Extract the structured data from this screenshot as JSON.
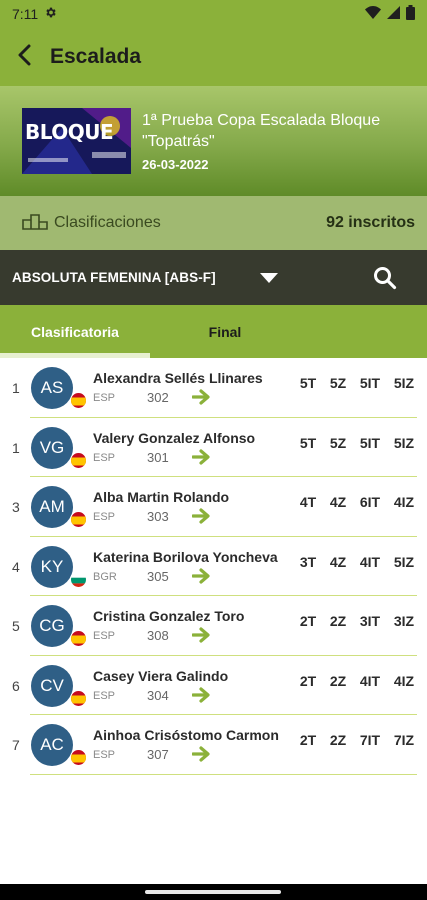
{
  "status_bar": {
    "time": "7:11",
    "settings_icon": "gear-icon",
    "wifi_icon": "wifi-icon",
    "signal_icon": "signal-icon",
    "battery_icon": "battery-icon"
  },
  "app_bar": {
    "title": "Escalada",
    "back_icon": "arrow-back-icon"
  },
  "event": {
    "thumbnail_text": "BLOQUE",
    "title": "1ª Prueba Copa Escalada Bloque \"Topatrás\"",
    "date": "26-03-2022"
  },
  "classification": {
    "label": "Clasificaciones",
    "icon": "podium-icon",
    "registered": "92 inscritos"
  },
  "category": {
    "selected": "ABSOLUTA FEMENINA [ABS-F]",
    "dropdown_icon": "caret-down-icon",
    "search_icon": "search-icon"
  },
  "tabs": [
    {
      "label": "Clasificatoria",
      "active": true
    },
    {
      "label": "Final",
      "active": false
    }
  ],
  "results": [
    {
      "rank": "1",
      "initials": "AS",
      "name": "Alexandra  Sellés Llinares",
      "country": "ESP",
      "flag": "spain-flag",
      "dorsal": "302",
      "tops": "5T",
      "zones": "5Z",
      "top_attempts": "5IT",
      "zone_attempts": "5IZ"
    },
    {
      "rank": "1",
      "initials": "VG",
      "name": "Valery Gonzalez Alfonso",
      "country": "ESP",
      "flag": "spain-flag",
      "dorsal": "301",
      "tops": "5T",
      "zones": "5Z",
      "top_attempts": "5IT",
      "zone_attempts": "5IZ"
    },
    {
      "rank": "3",
      "initials": "AM",
      "name": "Alba Martin Rolando",
      "country": "ESP",
      "flag": "spain-flag",
      "dorsal": "303",
      "tops": "4T",
      "zones": "4Z",
      "top_attempts": "6IT",
      "zone_attempts": "4IZ"
    },
    {
      "rank": "4",
      "initials": "KY",
      "name": "Katerina Borilova Yoncheva",
      "country": "BGR",
      "flag": "bulgaria-flag",
      "dorsal": "305",
      "tops": "3T",
      "zones": "4Z",
      "top_attempts": "4IT",
      "zone_attempts": "5IZ"
    },
    {
      "rank": "5",
      "initials": "CG",
      "name": "Cristina Gonzalez Toro",
      "country": "ESP",
      "flag": "spain-flag",
      "dorsal": "308",
      "tops": "2T",
      "zones": "2Z",
      "top_attempts": "3IT",
      "zone_attempts": "3IZ"
    },
    {
      "rank": "6",
      "initials": "CV",
      "name": "Casey Viera Galindo",
      "country": "ESP",
      "flag": "spain-flag",
      "dorsal": "304",
      "tops": "2T",
      "zones": "2Z",
      "top_attempts": "4IT",
      "zone_attempts": "4IZ"
    },
    {
      "rank": "7",
      "initials": "AC",
      "name": "Ainhoa Crisóstomo Carmon",
      "country": "ESP",
      "flag": "spain-flag",
      "dorsal": "307",
      "tops": "2T",
      "zones": "2Z",
      "top_attempts": "7IT",
      "zone_attempts": "7IZ"
    }
  ],
  "colors": {
    "primary": "#8bb13a",
    "dark_bar": "#373a2e",
    "avatar": "#2f5f86",
    "arrow": "#8bb13a"
  }
}
